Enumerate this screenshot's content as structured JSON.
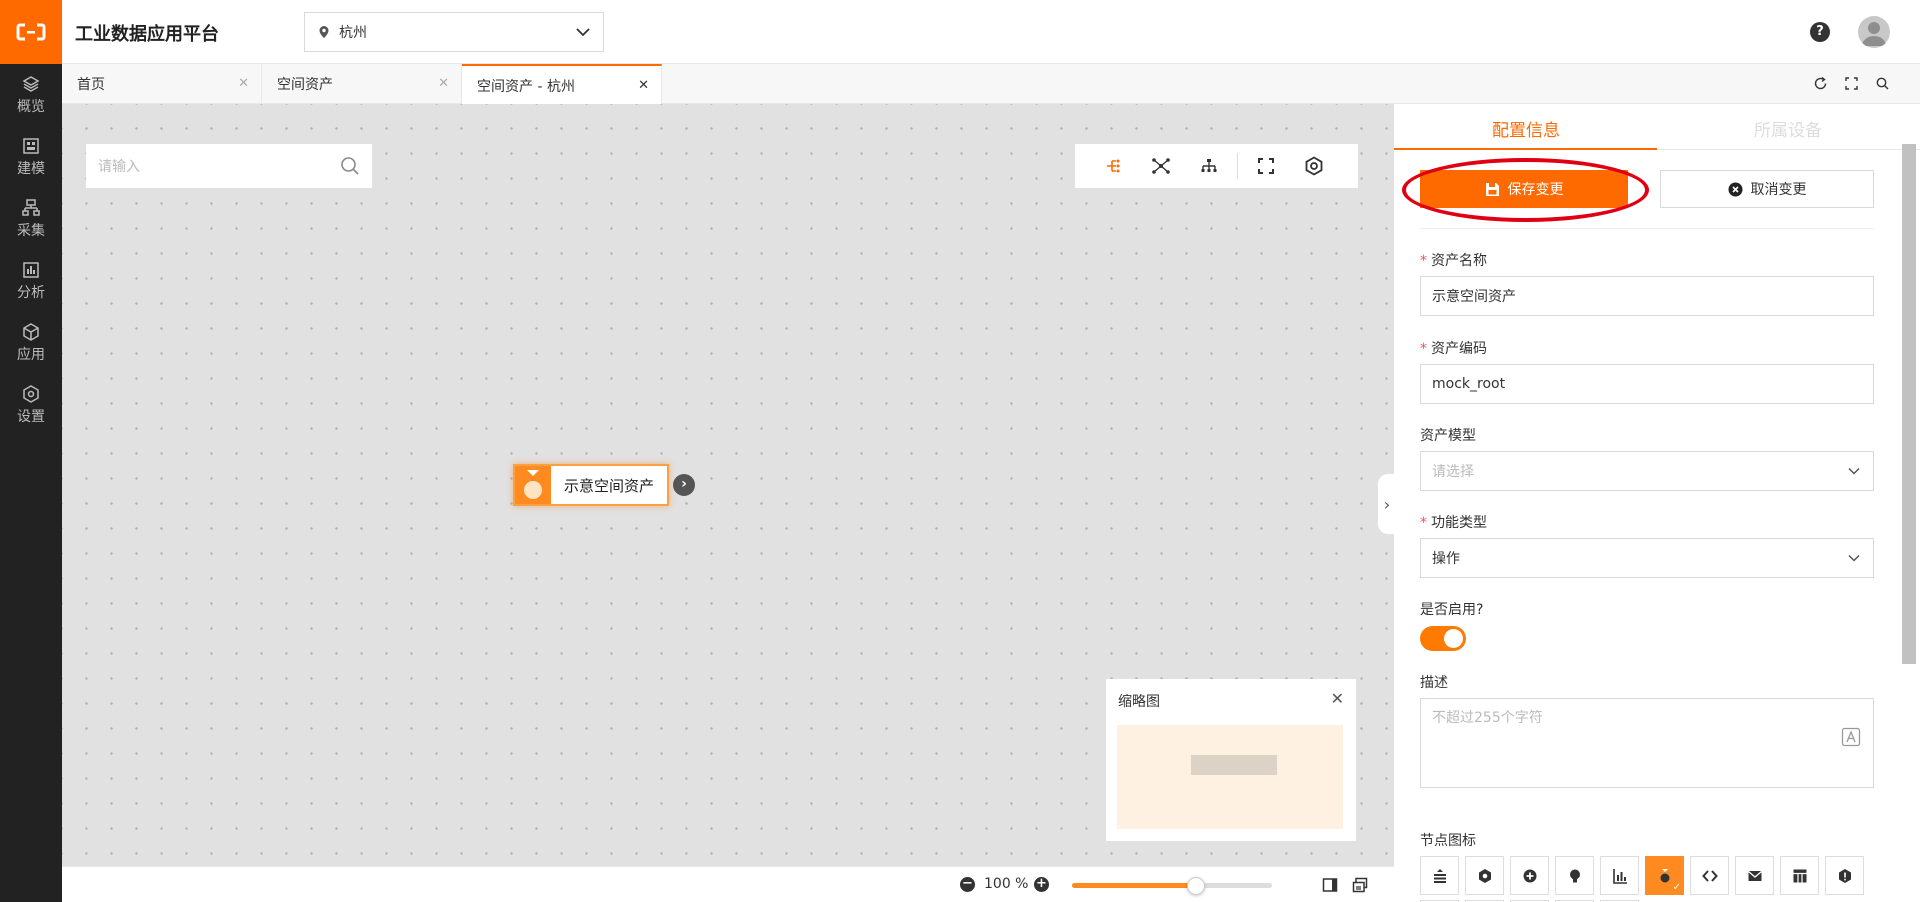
{
  "header": {
    "app_title": "工业数据应用平台",
    "city": "杭州",
    "help_label": "?"
  },
  "sidebar": {
    "items": [
      {
        "label": "概览",
        "icon": "layers-icon"
      },
      {
        "label": "建模",
        "icon": "grid-box-icon"
      },
      {
        "label": "采集",
        "icon": "hierarchy-icon"
      },
      {
        "label": "分析",
        "icon": "bar-chart-icon"
      },
      {
        "label": "应用",
        "icon": "cube-icon"
      },
      {
        "label": "设置",
        "icon": "settings-icon"
      }
    ]
  },
  "tabs": [
    {
      "label": "首页",
      "active": false
    },
    {
      "label": "空间资产",
      "active": false
    },
    {
      "label": "空间资产 - 杭州",
      "active": true
    }
  ],
  "canvas": {
    "search_placeholder": "请输入",
    "node_label": "示意空间资产",
    "minimap_title": "缩略图"
  },
  "zoom": {
    "value": "100 %",
    "level": 0.62
  },
  "panel": {
    "tab_config": "配置信息",
    "tab_devices": "所属设备",
    "save_label": "保存变更",
    "cancel_label": "取消变更",
    "asset_name_label": "资产名称",
    "asset_name_value": "示意空间资产",
    "asset_code_label": "资产编码",
    "asset_code_value": "mock_root",
    "asset_model_label": "资产模型",
    "asset_model_placeholder": "请选择",
    "func_type_label": "功能类型",
    "func_type_value": "操作",
    "enabled_label": "是否启用?",
    "enabled": true,
    "desc_label": "描述",
    "desc_placeholder": "不超过255个字符",
    "node_icon_label": "节点图标"
  },
  "colors": {
    "brand": "#ff6a00",
    "sidebar": "#222222",
    "highlight_ring": "#e00012"
  }
}
